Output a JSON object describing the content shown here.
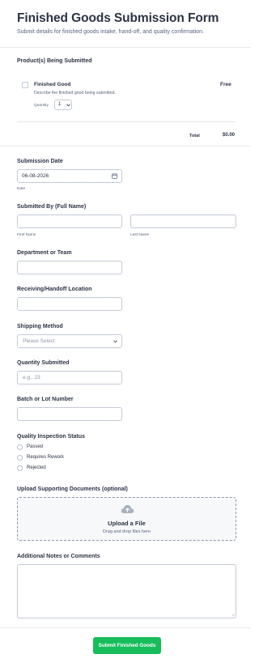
{
  "header": {
    "title": "Finished Goods Submission Form",
    "subtitle": "Submit details for finished goods intake, hand-off, and quality confirmation."
  },
  "products": {
    "label": "Product(s) Being Submitted",
    "item": {
      "name": "Finished Good",
      "price": "Free",
      "description": "Describe the finished good being submitted.",
      "quantity_label": "Quantity",
      "quantity_value": "1"
    },
    "total_label": "Total",
    "total_value": "$0.00"
  },
  "submission_date": {
    "label": "Submission Date",
    "value": "06-08-2026",
    "sublabel": "Date"
  },
  "submitted_by": {
    "label": "Submitted By (Full Name)",
    "first_sublabel": "First Name",
    "last_sublabel": "Last Name"
  },
  "department": {
    "label": "Department or Team"
  },
  "location": {
    "label": "Receiving/Handoff Location"
  },
  "shipping": {
    "label": "Shipping Method",
    "placeholder": "Please Select"
  },
  "quantity_submitted": {
    "label": "Quantity Submitted",
    "placeholder": "e.g., 23"
  },
  "batch": {
    "label": "Batch or Lot Number"
  },
  "quality": {
    "label": "Quality Inspection Status",
    "options": [
      "Passed",
      "Requires Rework",
      "Rejected"
    ]
  },
  "upload": {
    "label": "Upload Supporting Documents (optional)",
    "title": "Upload a File",
    "hint": "Drag and drop files here"
  },
  "notes": {
    "label": "Additional Notes or Comments"
  },
  "submit": {
    "label": "Submit Finished Goods"
  },
  "colors": {
    "accent": "#18bd5b",
    "text": "#2c3345",
    "muted": "#57647e",
    "border": "#c3cad8"
  }
}
